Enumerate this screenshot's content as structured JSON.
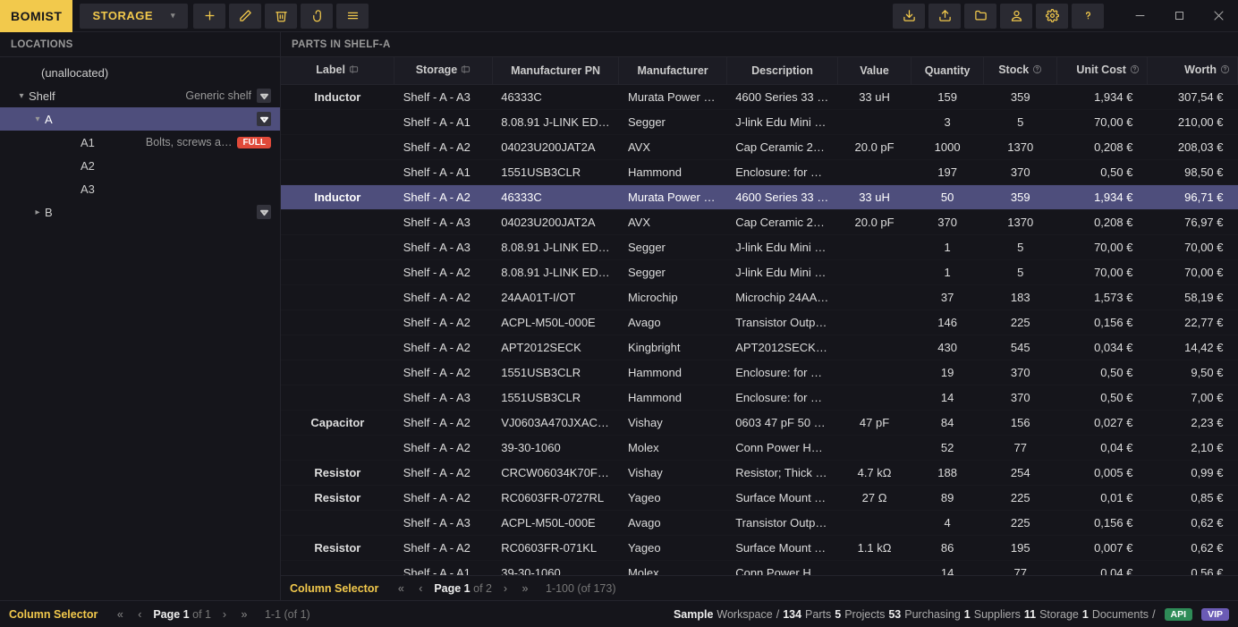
{
  "app": {
    "logo": "BOMIST",
    "context": "STORAGE"
  },
  "sidebar": {
    "title": "LOCATIONS",
    "items": [
      {
        "label": "(unallocated)",
        "desc": "",
        "depth": 0,
        "expander": "",
        "menu": false
      },
      {
        "label": "Shelf",
        "desc": "Generic shelf",
        "depth": 1,
        "expander": "▾",
        "menu": true
      },
      {
        "label": "A",
        "desc": "",
        "depth": 2,
        "expander": "▾",
        "menu": true,
        "selected": true
      },
      {
        "label": "A1",
        "desc": "Bolts, screws a…",
        "depth": 3,
        "expander": "",
        "badge": "FULL"
      },
      {
        "label": "A2",
        "desc": "",
        "depth": 3,
        "expander": ""
      },
      {
        "label": "A3",
        "desc": "",
        "depth": 3,
        "expander": ""
      },
      {
        "label": "B",
        "desc": "",
        "depth": 2,
        "expander": "▸",
        "menu": true
      }
    ]
  },
  "content": {
    "title": "PARTS IN SHELF-A",
    "columns": [
      "Label",
      "Storage",
      "Manufacturer PN",
      "Manufacturer",
      "Description",
      "Value",
      "Quantity",
      "Stock",
      "Unit Cost",
      "Worth"
    ],
    "rows": [
      {
        "label": "Inductor",
        "storage": "Shelf - A - A3",
        "mpn": "46333C",
        "manu": "Murata Power S…",
        "desc": "4600 Series 33 u…",
        "value": "33 uH",
        "qty": "159",
        "stock": "359",
        "unit": "1,934 €",
        "worth": "307,54 €"
      },
      {
        "label": "",
        "storage": "Shelf - A - A1",
        "mpn": "8.08.91 J-LINK EDU…",
        "manu": "Segger",
        "desc": "J-link Edu Mini R…",
        "value": "",
        "qty": "3",
        "stock": "5",
        "unit": "70,00 €",
        "worth": "210,00 €"
      },
      {
        "label": "",
        "storage": "Shelf - A - A2",
        "mpn": "04023U200JAT2A",
        "manu": "AVX",
        "desc": "Cap Ceramic 20p…",
        "value": "20.0 pF",
        "qty": "1000",
        "stock": "1370",
        "unit": "0,208 €",
        "worth": "208,03 €"
      },
      {
        "label": "",
        "storage": "Shelf - A - A1",
        "mpn": "1551USB3CLR",
        "manu": "Hammond",
        "desc": "Enclosure: for US…",
        "value": "",
        "qty": "197",
        "stock": "370",
        "unit": "0,50 €",
        "worth": "98,50 €"
      },
      {
        "label": "Inductor",
        "storage": "Shelf - A - A2",
        "mpn": "46333C",
        "manu": "Murata Power S…",
        "desc": "4600 Series 33 u…",
        "value": "33 uH",
        "qty": "50",
        "stock": "359",
        "unit": "1,934 €",
        "worth": "96,71 €",
        "selected": true
      },
      {
        "label": "",
        "storage": "Shelf - A - A3",
        "mpn": "04023U200JAT2A",
        "manu": "AVX",
        "desc": "Cap Ceramic 20p…",
        "value": "20.0 pF",
        "qty": "370",
        "stock": "1370",
        "unit": "0,208 €",
        "worth": "76,97 €"
      },
      {
        "label": "",
        "storage": "Shelf - A - A3",
        "mpn": "8.08.91 J-LINK EDU…",
        "manu": "Segger",
        "desc": "J-link Edu Mini R…",
        "value": "",
        "qty": "1",
        "stock": "5",
        "unit": "70,00 €",
        "worth": "70,00 €"
      },
      {
        "label": "",
        "storage": "Shelf - A - A2",
        "mpn": "8.08.91 J-LINK EDU…",
        "manu": "Segger",
        "desc": "J-link Edu Mini R…",
        "value": "",
        "qty": "1",
        "stock": "5",
        "unit": "70,00 €",
        "worth": "70,00 €"
      },
      {
        "label": "",
        "storage": "Shelf - A - A2",
        "mpn": "24AA01T-I/OT",
        "manu": "Microchip",
        "desc": "Microchip 24AA0…",
        "value": "",
        "qty": "37",
        "stock": "183",
        "unit": "1,573 €",
        "worth": "58,19 €"
      },
      {
        "label": "",
        "storage": "Shelf - A - A2",
        "mpn": "ACPL-M50L-000E",
        "manu": "Avago",
        "desc": "Transistor Outpu…",
        "value": "",
        "qty": "146",
        "stock": "225",
        "unit": "0,156 €",
        "worth": "22,77 €"
      },
      {
        "label": "",
        "storage": "Shelf - A - A2",
        "mpn": "APT2012SECK",
        "manu": "Kingbright",
        "desc": "APT2012SECK Or…",
        "value": "",
        "qty": "430",
        "stock": "545",
        "unit": "0,034 €",
        "worth": "14,42 €"
      },
      {
        "label": "",
        "storage": "Shelf - A - A2",
        "mpn": "1551USB3CLR",
        "manu": "Hammond",
        "desc": "Enclosure: for US…",
        "value": "",
        "qty": "19",
        "stock": "370",
        "unit": "0,50 €",
        "worth": "9,50 €"
      },
      {
        "label": "",
        "storage": "Shelf - A - A3",
        "mpn": "1551USB3CLR",
        "manu": "Hammond",
        "desc": "Enclosure: for US…",
        "value": "",
        "qty": "14",
        "stock": "370",
        "unit": "0,50 €",
        "worth": "7,00 €"
      },
      {
        "label": "Capacitor",
        "storage": "Shelf - A - A2",
        "mpn": "VJ0603A470JXACW…",
        "manu": "Vishay",
        "desc": "0603 47 pF 50 V …",
        "value": "47 pF",
        "qty": "84",
        "stock": "156",
        "unit": "0,027 €",
        "worth": "2,23 €"
      },
      {
        "label": "",
        "storage": "Shelf - A - A2",
        "mpn": "39-30-1060",
        "manu": "Molex",
        "desc": "Conn Power HDR…",
        "value": "",
        "qty": "52",
        "stock": "77",
        "unit": "0,04 €",
        "worth": "2,10 €"
      },
      {
        "label": "Resistor",
        "storage": "Shelf - A - A2",
        "mpn": "CRCW06034K70FK…",
        "manu": "Vishay",
        "desc": "Resistor; Thick Fil…",
        "value": "4.7 kΩ",
        "qty": "188",
        "stock": "254",
        "unit": "0,005 €",
        "worth": "0,99 €"
      },
      {
        "label": "Resistor",
        "storage": "Shelf - A - A2",
        "mpn": "RC0603FR-0727RL",
        "manu": "Yageo",
        "desc": "Surface Mount T…",
        "value": "27 Ω",
        "qty": "89",
        "stock": "225",
        "unit": "0,01 €",
        "worth": "0,85 €"
      },
      {
        "label": "",
        "storage": "Shelf - A - A3",
        "mpn": "ACPL-M50L-000E",
        "manu": "Avago",
        "desc": "Transistor Outpu…",
        "value": "",
        "qty": "4",
        "stock": "225",
        "unit": "0,156 €",
        "worth": "0,62 €"
      },
      {
        "label": "Resistor",
        "storage": "Shelf - A - A2",
        "mpn": "RC0603FR-071KL",
        "manu": "Yageo",
        "desc": "Surface Mount T…",
        "value": "1.1 kΩ",
        "qty": "86",
        "stock": "195",
        "unit": "0,007 €",
        "worth": "0,62 €"
      },
      {
        "label": "",
        "storage": "Shelf - A - A1",
        "mpn": "39-30-1060",
        "manu": "Molex",
        "desc": "Conn Power HDR…",
        "value": "",
        "qty": "14",
        "stock": "77",
        "unit": "0,04 €",
        "worth": "0,56 €"
      }
    ],
    "pager": {
      "colsel": "Column Selector",
      "page_label": "Page 1",
      "of": " of 2",
      "range": "1-100 (of 173)"
    }
  },
  "footer": {
    "colsel": "Column Selector",
    "page_label": "Page 1",
    "of": " of 1",
    "range": "1-1 (of 1)",
    "workspace": "Sample",
    "ws_label": "Workspace",
    "parts_n": "134",
    "parts_l": "Parts",
    "projects_n": "5",
    "projects_l": "Projects",
    "purch_n": "53",
    "purch_l": "Purchasing",
    "supp_n": "1",
    "supp_l": "Suppliers",
    "storage_n": "11",
    "storage_l": "Storage",
    "docs_n": "1",
    "docs_l": "Documents",
    "api": "API",
    "vip": "VIP"
  }
}
